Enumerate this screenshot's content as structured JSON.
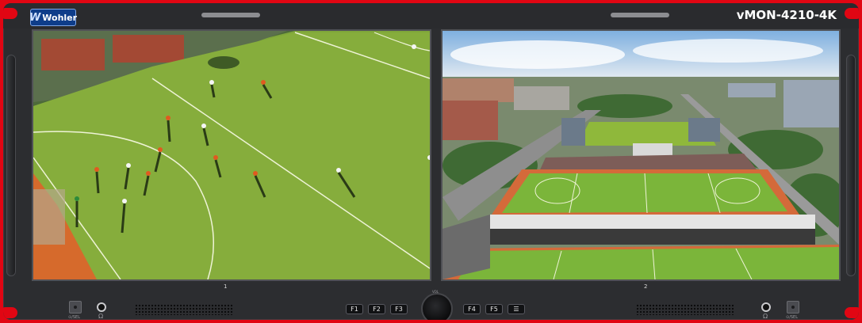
{
  "device": {
    "brand": "Wohler",
    "model": "vMON-4210-4K",
    "accent_color": "#e10613",
    "panel_color": "#2c2d30"
  },
  "screens": [
    {
      "channel_label": "1",
      "content": "soccer-match-closeup"
    },
    {
      "channel_label": "2",
      "content": "stadium-aerial-view"
    }
  ],
  "controls": {
    "left_select_label": "⊙/SEL",
    "right_select_label": "⊙/SEL",
    "function_keys": [
      "F1",
      "F2",
      "F3",
      "F4",
      "F5",
      "☰"
    ],
    "knob_label": "VOL",
    "headphone_icon": "Ω"
  }
}
